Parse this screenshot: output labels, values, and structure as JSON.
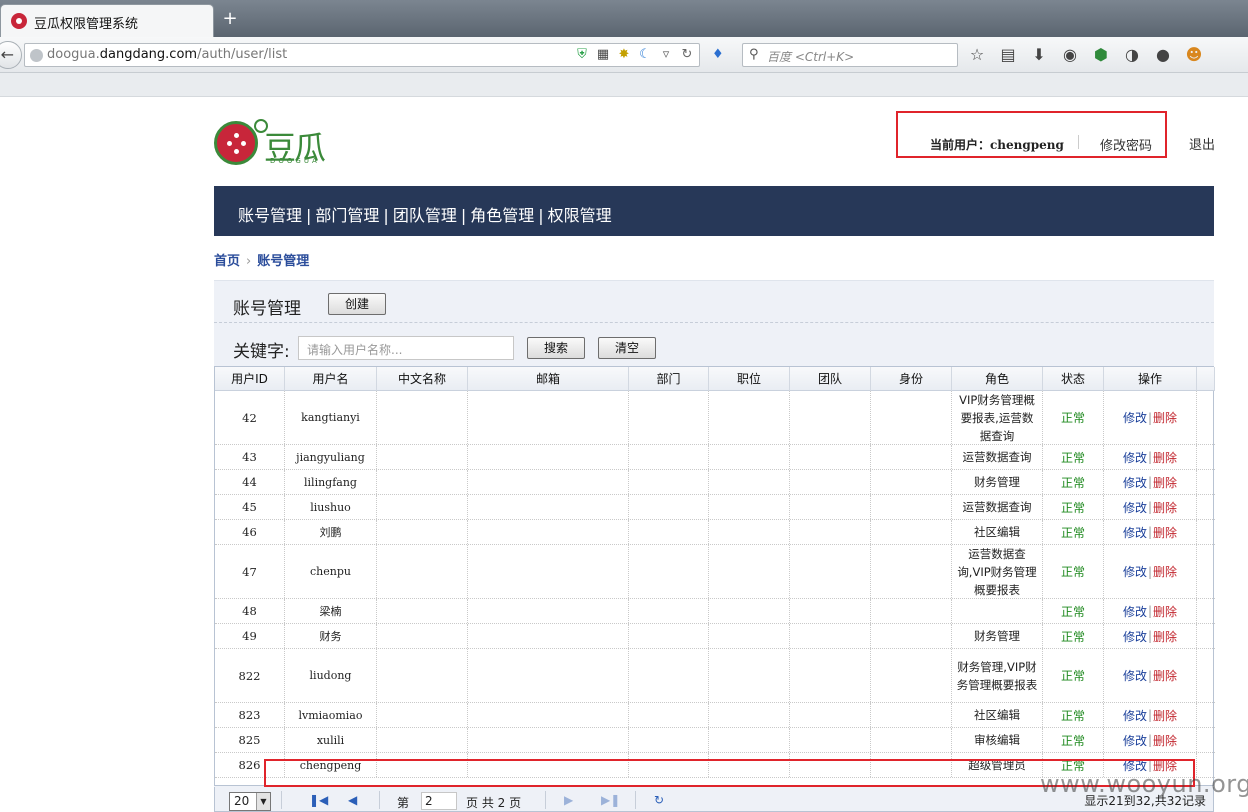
{
  "browser": {
    "tab_title": "豆瓜权限管理系统",
    "new_tab": "+",
    "url_host_prefix": "doogua.",
    "url_host_main": "dangdang.com",
    "url_path": "/auth/user/list",
    "search_placeholder": "百度 <Ctrl+K>"
  },
  "header": {
    "logo_cn": "豆瓜",
    "logo_en": "DOOGUA",
    "current_user": "当前用户：chengpeng",
    "change_password": "修改密码",
    "logout": "退出"
  },
  "nav": {
    "items": [
      "账号管理",
      "部门管理",
      "团队管理",
      "角色管理",
      "权限管理"
    ],
    "separator": "|"
  },
  "breadcrumb": {
    "home": "首页",
    "current": "账号管理",
    "arrow": "›"
  },
  "panel": {
    "title": "账号管理",
    "create": "创建",
    "keyword_label": "关键字:",
    "keyword_placeholder": "请输入用户名称...",
    "search": "搜索",
    "clear": "清空"
  },
  "table": {
    "columns": [
      "用户ID",
      "用户名",
      "中文名称",
      "邮箱",
      "部门",
      "职位",
      "团队",
      "身份",
      "角色",
      "状态",
      "操作"
    ],
    "edit_label": "修改",
    "delete_label": "删除",
    "rows": [
      {
        "id": "42",
        "name": "kangtianyi",
        "role": "VIP财务管理概要报表,运营数据查询",
        "status": "正常"
      },
      {
        "id": "43",
        "name": "jiangyuliang",
        "role": "运营数据查询",
        "status": "正常"
      },
      {
        "id": "44",
        "name": "lilingfang",
        "role": "财务管理",
        "status": "正常"
      },
      {
        "id": "45",
        "name": "liushuo",
        "role": "运营数据查询",
        "status": "正常"
      },
      {
        "id": "46",
        "name": "刘鹏",
        "role": "社区编辑",
        "status": "正常"
      },
      {
        "id": "47",
        "name": "chenpu",
        "role": "运营数据查询,VIP财务管理概要报表",
        "status": "正常"
      },
      {
        "id": "48",
        "name": "梁楠",
        "role": "",
        "status": "正常"
      },
      {
        "id": "49",
        "name": "财务",
        "role": "财务管理",
        "status": "正常"
      },
      {
        "id": "822",
        "name": "liudong",
        "role": "财务管理,VIP财务管理概要报表",
        "status": "正常"
      },
      {
        "id": "823",
        "name": "lvmiaomiao",
        "role": "社区编辑",
        "status": "正常"
      },
      {
        "id": "825",
        "name": "xulili",
        "role": "审核编辑",
        "status": "正常"
      },
      {
        "id": "826",
        "name": "chengpeng",
        "role": "超级管理员",
        "status": "正常"
      }
    ]
  },
  "pager": {
    "page_size": "20",
    "page_label_prefix": "第",
    "current_page": "2",
    "page_label_suffix": "页 共 2 页",
    "info": "显示21到32,共32记录"
  },
  "watermark": "www.wooyun.org"
}
